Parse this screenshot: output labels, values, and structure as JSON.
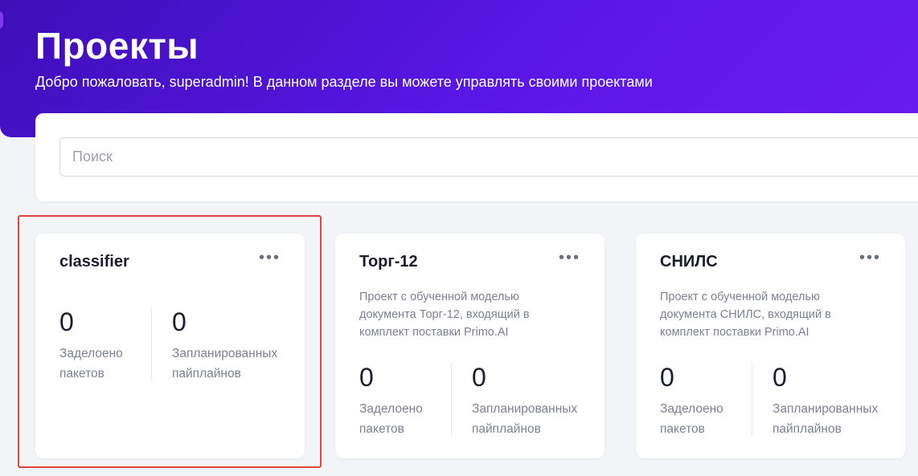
{
  "header": {
    "title": "Проекты",
    "subtitle": "Добро пожаловать, superadmin! В данном разделе вы можете управлять своими проектами"
  },
  "search": {
    "placeholder": "Поиск",
    "value": ""
  },
  "projects": [
    {
      "name": "classifier",
      "description": "",
      "deployed_count": "0",
      "deployed_label": "Заделоено пакетов",
      "pipelines_count": "0",
      "pipelines_label": "Запланированных пайплайнов",
      "menu_icon": "more-horizontal-icon"
    },
    {
      "name": "Торг-12",
      "description": "Проект с обученной моделью документа Торг-12, входящий в комплект поставки Primo.AI",
      "deployed_count": "0",
      "deployed_label": "Заделоено пакетов",
      "pipelines_count": "0",
      "pipelines_label": "Запланированных пайплайнов",
      "menu_icon": "more-horizontal-icon"
    },
    {
      "name": "СНИЛС",
      "description": "Проект с обученной моделью документа СНИЛС, входящий в комплект поставки Primo.AI",
      "deployed_count": "0",
      "deployed_label": "Заделоено пакетов",
      "pipelines_count": "0",
      "pipelines_label": "Запланированных пайплайнов",
      "menu_icon": "more-horizontal-icon"
    }
  ],
  "colors": {
    "accent": "#5a16e6",
    "highlight": "#e0463c",
    "background": "#f3f4f8"
  }
}
